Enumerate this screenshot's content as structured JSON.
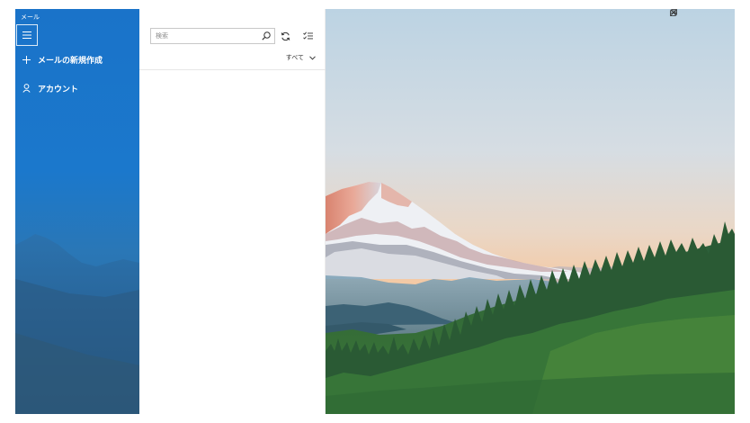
{
  "app": {
    "title": "メール"
  },
  "sidebar": {
    "menu_icon": "hamburger-icon",
    "items": [
      {
        "label": "メールの新規作成",
        "icon": "plus-icon"
      },
      {
        "label": "アカウント",
        "icon": "person-icon"
      }
    ]
  },
  "list": {
    "search": {
      "placeholder": "検索",
      "value": "",
      "icon": "search-icon"
    },
    "sync_icon": "sync-icon",
    "selection_mode_icon": "selection-mode-icon",
    "filter": {
      "label": "すべて",
      "icon": "chevron-down-icon"
    }
  },
  "window_controls": {
    "minimize_icon": "minimize-icon",
    "restore_icon": "restore-icon",
    "close_icon": "close-icon"
  },
  "colors": {
    "accent": "#1a73c9",
    "sky_top": "#bcd3e3",
    "sky_horizon": "#f4c9a4",
    "forest": "#2e6b34"
  }
}
